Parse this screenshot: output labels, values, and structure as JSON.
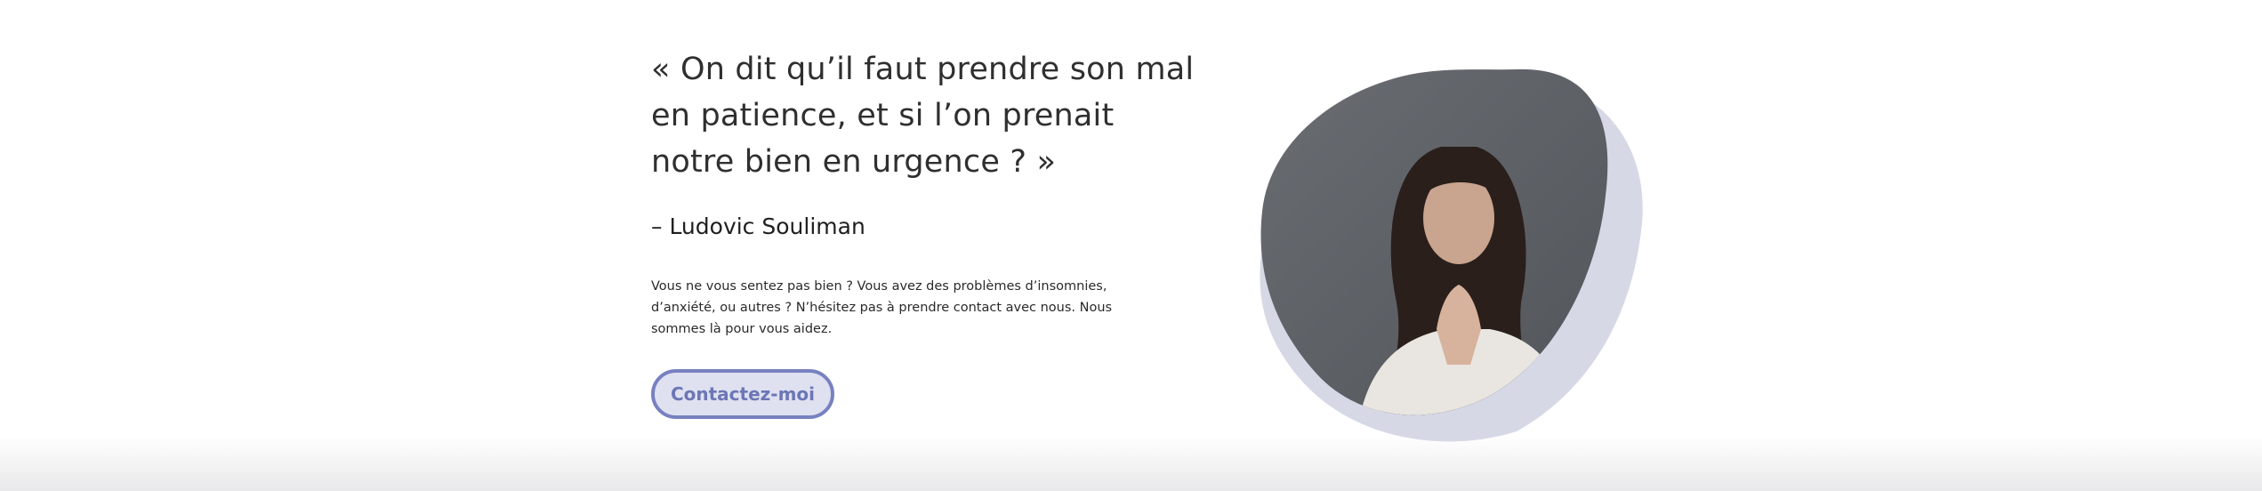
{
  "quote": {
    "text": "« On dit qu’il faut prendre son mal en patience, et si l’on prenait notre bien en urgence ? »",
    "author": "– Ludovic Souliman"
  },
  "description": "Vous ne vous sentez pas bien ? Vous avez des problèmes d’insomnies, d’anxiété, ou autres ? N’hésitez pas à prendre contact avec nous. Nous sommes là pour vous aidez.",
  "cta": {
    "label": "Contactez-moi"
  },
  "colors": {
    "accent": "#7881c0",
    "accent_bg": "#dfe1f1",
    "blob_back": "#d6d8e6",
    "photo_bg": "#5d6166"
  },
  "image": {
    "subject": "woman-praying-photo"
  }
}
